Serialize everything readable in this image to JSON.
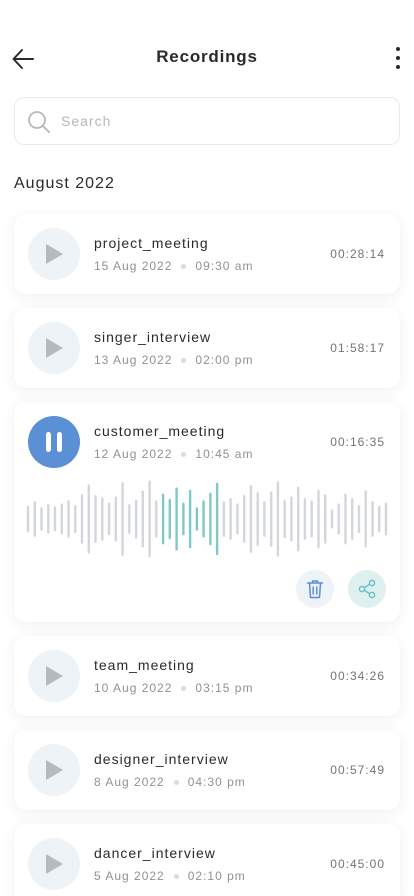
{
  "header": {
    "title": "Recordings"
  },
  "search": {
    "placeholder": "Search",
    "value": ""
  },
  "section": {
    "title": "August 2022"
  },
  "recordings": [
    {
      "name": "project_meeting",
      "date": "15 Aug 2022",
      "time": "09:30 am",
      "duration": "00:28:14",
      "state": "paused"
    },
    {
      "name": "singer_interview",
      "date": "13 Aug 2022",
      "time": "02:00 pm",
      "duration": "01:58:17",
      "state": "paused"
    },
    {
      "name": "customer_meeting",
      "date": "12 Aug 2022",
      "time": "10:45 am",
      "duration": "00:16:35",
      "state": "playing"
    },
    {
      "name": "team_meeting",
      "date": "10 Aug 2022",
      "time": "03:15 pm",
      "duration": "00:34:26",
      "state": "paused"
    },
    {
      "name": "designer_interview",
      "date": "8 Aug 2022",
      "time": "04:30 pm",
      "duration": "00:57:49",
      "state": "paused"
    },
    {
      "name": "dancer_interview",
      "date": "5 Aug 2022",
      "time": "02:10 pm",
      "duration": "00:45:00",
      "state": "paused"
    }
  ],
  "icons": {
    "back": "arrow-left-icon",
    "more": "more-vertical-icon",
    "search": "search-icon",
    "play": "play-icon",
    "pause": "pause-icon",
    "delete": "trash-icon",
    "share": "share-icon"
  },
  "colors": {
    "accent": "#5b8fd6",
    "waveform_active": "#7ec8c9",
    "waveform_inactive": "#d3d6da",
    "play_bg": "#eef3f8",
    "share_bg": "#dff0f0"
  },
  "waveform": {
    "levels": [
      0.32,
      0.44,
      0.28,
      0.36,
      0.3,
      0.38,
      0.46,
      0.34,
      0.62,
      0.88,
      0.6,
      0.54,
      0.4,
      0.56,
      0.94,
      0.36,
      0.48,
      0.72,
      0.98,
      0.46,
      0.64,
      0.5,
      0.8,
      0.4,
      0.74,
      0.28,
      0.46,
      0.66,
      0.92,
      0.44,
      0.52,
      0.38,
      0.6,
      0.86,
      0.68,
      0.44,
      0.7,
      0.96,
      0.48,
      0.56,
      0.82,
      0.52,
      0.46,
      0.74,
      0.62,
      0.22,
      0.38,
      0.64,
      0.52,
      0.34,
      0.72,
      0.44,
      0.32,
      0.4
    ],
    "played_fraction": 0.52,
    "active_range": [
      0.385,
      0.52
    ]
  }
}
